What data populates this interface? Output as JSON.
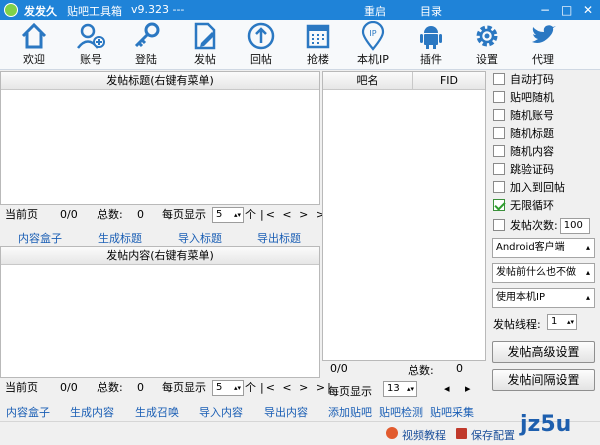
{
  "window": {
    "title": "发发久",
    "subtitle": "贴吧工具箱",
    "version": "v9.323 ---",
    "menu": [
      "重启",
      "目录"
    ],
    "controls": [
      "−",
      "□",
      "✕"
    ]
  },
  "toolbar": [
    {
      "label": "欢迎",
      "icon": "home-icon"
    },
    {
      "label": "账号",
      "icon": "add-user-icon"
    },
    {
      "label": "登陆",
      "icon": "key-icon"
    },
    {
      "label": "发帖",
      "icon": "edit-icon"
    },
    {
      "label": "回帖",
      "icon": "reply-icon"
    },
    {
      "label": "抢楼",
      "icon": "calendar-icon"
    },
    {
      "label": "本机IP",
      "icon": "ip-pin-icon"
    },
    {
      "label": "插件",
      "icon": "android-icon"
    },
    {
      "label": "设置",
      "icon": "gear-icon"
    },
    {
      "label": "代理",
      "icon": "bird-icon"
    }
  ],
  "title_panel": {
    "header": "发帖标题(右键有菜单)",
    "pager": {
      "current_label": "当前页",
      "current": "0/0",
      "total_label": "总数:",
      "total": "0",
      "per_page_label": "每页显示",
      "per_page": "5",
      "unit": "个",
      "nav": "|< < > >|"
    },
    "links": [
      "内容盒子",
      "生成标题",
      "导入标题",
      "导出标题"
    ]
  },
  "content_panel": {
    "header": "发帖内容(右键有菜单)",
    "pager": {
      "current_label": "当前页",
      "current": "0/0",
      "total_label": "总数:",
      "total": "0",
      "per_page_label": "每页显示",
      "per_page": "5",
      "unit": "个",
      "nav": "|< < > >|"
    },
    "links": [
      "内容盒子",
      "生成内容",
      "生成召唤",
      "导入内容",
      "导出内容"
    ]
  },
  "bar_panel": {
    "columns": [
      "吧名",
      "FID"
    ],
    "count": "0/0",
    "total_label": "总数:",
    "total": "0",
    "per_page_label": "每页显示",
    "per_page": "13",
    "nav": "◂ ▸",
    "links": [
      "添加贴吧",
      "贴吧检测",
      "贴吧采集"
    ]
  },
  "options": [
    {
      "label": "自动打码",
      "checked": false
    },
    {
      "label": "贴吧随机",
      "checked": false
    },
    {
      "label": "随机账号",
      "checked": false
    },
    {
      "label": "随机标题",
      "checked": false
    },
    {
      "label": "随机内容",
      "checked": false
    },
    {
      "label": "跳验证码",
      "checked": false
    },
    {
      "label": "加入到回帖",
      "checked": false
    },
    {
      "label": "无限循环",
      "checked": true
    }
  ],
  "post_count": {
    "label": "发帖次数:",
    "value": "100",
    "checked": false
  },
  "selects": [
    {
      "value": "Android客户端"
    },
    {
      "value": "发帖前什么也不做"
    },
    {
      "value": "使用本机IP"
    }
  ],
  "threads": {
    "label": "发帖线程:",
    "value": "1"
  },
  "buttons": [
    "发帖高级设置",
    "发帖间隔设置"
  ],
  "statusbar": {
    "video": "视频教程",
    "save": "保存配置",
    "watermark": "jz5u"
  },
  "colors": {
    "titlebar": "#1f83d8",
    "link": "#1b5fb5",
    "icon": "#2b78c2"
  }
}
